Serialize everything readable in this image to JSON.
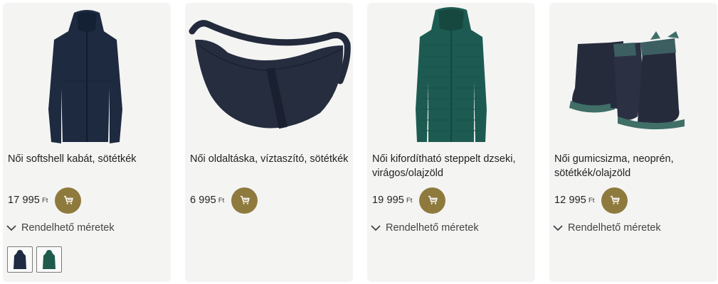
{
  "currency": "Ft",
  "sizes_label": "Rendelhető méretek",
  "products": [
    {
      "title": "Női softshell kabát, sötétkék",
      "price": "17 995",
      "image": "navy-softshell-coat",
      "color": "#1d2a3f",
      "has_sizes": true,
      "swatches": [
        {
          "color": "#1f2b42"
        },
        {
          "color": "#1f5a4d"
        }
      ]
    },
    {
      "title": "Női oldaltáska, víztaszító, sötétkék",
      "price": "6 995",
      "image": "navy-crossbody-bag",
      "color": "#262d3f",
      "has_sizes": false,
      "swatches": []
    },
    {
      "title": "Női kifordítható steppelt dzseki, virágos/olajzöld",
      "price": "19 995",
      "image": "teal-quilted-jacket",
      "color": "#1d5b52",
      "has_sizes": true,
      "swatches": []
    },
    {
      "title": "Női gumicsizma, neoprén, sötétkék/olajzöld",
      "price": "12 995",
      "image": "navy-rubber-boots",
      "color": "#262b3c",
      "has_sizes": true,
      "swatches": []
    }
  ],
  "colors": {
    "cart_button": "#8f7a3e",
    "card_bg": "#f4f4f3"
  }
}
